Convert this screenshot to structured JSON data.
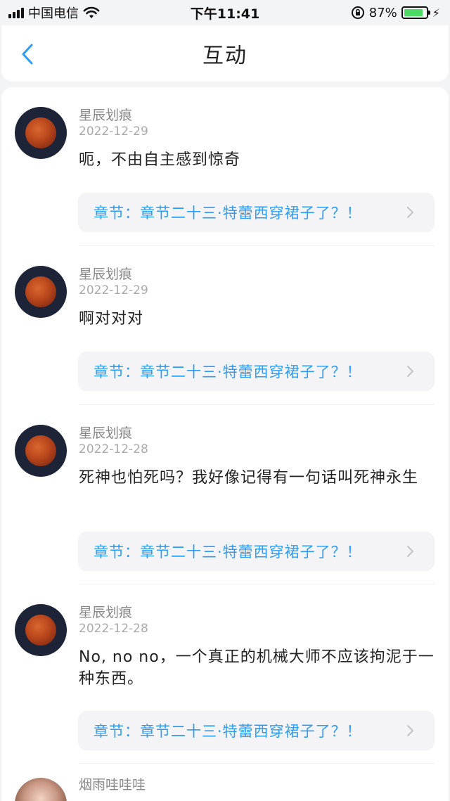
{
  "status_bar": {
    "carrier": "中国电信",
    "time": "下午11:41",
    "battery": "87%",
    "battery_level": 0.87
  },
  "header": {
    "title": "互动",
    "back_icon": "chevron-left-icon"
  },
  "comments": [
    {
      "user": "星辰划痕",
      "date": "2022-12-29",
      "text": "呃，不由自主感到惊奇",
      "chapter": "章节：章节二十三·特蕾西穿裙子了？！"
    },
    {
      "user": "星辰划痕",
      "date": "2022-12-29",
      "text": "啊对对对",
      "chapter": "章节：章节二十三·特蕾西穿裙子了？！"
    },
    {
      "user": "星辰划痕",
      "date": "2022-12-28",
      "text": "死神也怕死吗？我好像记得有一句话叫死神永生",
      "chapter": "章节：章节二十三·特蕾西穿裙子了？！"
    },
    {
      "user": "星辰划痕",
      "date": "2022-12-28",
      "text": "No, no no，一个真正的机械大师不应该拘泥于一种东西。",
      "chapter": "章节：章节二十三·特蕾西穿裙子了？！"
    }
  ],
  "partial_comment": {
    "user": "烟雨哇哇哇"
  },
  "colors": {
    "accent": "#2d9df1",
    "background": "#f3f4f6"
  }
}
